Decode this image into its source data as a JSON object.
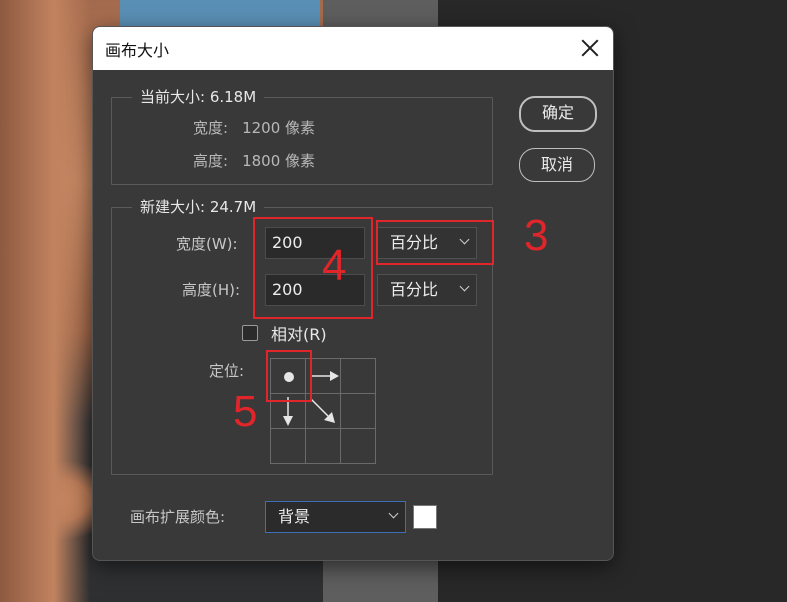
{
  "dialog": {
    "title": "画布大小",
    "current_size": {
      "label": "当前大小: 6.18M",
      "width_label": "宽度:",
      "width_value": "1200 像素",
      "height_label": "高度:",
      "height_value": "1800 像素"
    },
    "new_size": {
      "label": "新建大小: 24.7M",
      "width_label": "宽度(W):",
      "width_value": "200",
      "width_unit": "百分比",
      "height_label": "高度(H):",
      "height_value": "200",
      "height_unit": "百分比",
      "relative_label": "相对(R)",
      "relative_checked": false,
      "anchor_label": "定位:"
    },
    "canvas_ext_color_label": "画布扩展颜色:",
    "canvas_ext_color_value": "背景",
    "swatch_color": "#ffffff",
    "buttons": {
      "ok": "确定",
      "cancel": "取消"
    }
  },
  "annotations": {
    "num3": "3",
    "num4": "4",
    "num5": "5",
    "color": "#e0252b"
  }
}
